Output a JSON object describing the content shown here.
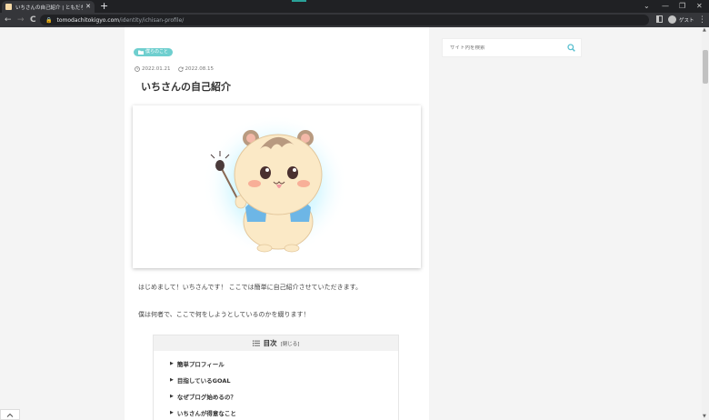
{
  "browser": {
    "tab_title": "いちさんの自己紹介 | ともだちと起業",
    "tab_close": "✕",
    "new_tab": "+",
    "url_host": "tomodachitokigyo.com",
    "url_path": "/identity/ichisan-profile/",
    "profile_label": "ゲスト",
    "back": "←",
    "forward": "→",
    "reload": "C",
    "minimize": "—",
    "restore": "❐",
    "close": "✕",
    "dropdown": "⌄",
    "menu": "⋮"
  },
  "article": {
    "category": "僕らのこと",
    "published": "2022.01.21",
    "updated": "2022.08.15",
    "title": "いちさんの自己紹介",
    "intro1": "はじめまして！いちさんです！ ここでは簡単に自己紹介させていただきます。",
    "intro2": "僕は何者で、ここで何をしようとしているのかを綴ります！"
  },
  "toc": {
    "title": "目次",
    "toggle": "[閉じる]",
    "items": [
      "簡単プロフィール",
      "目指しているGOAL",
      "なぜブログ始めるの？",
      "いちさんが得意なこと"
    ]
  },
  "sidebar": {
    "search_placeholder": "サイト内を検索"
  },
  "colors": {
    "accent": "#6fcfcf",
    "search_icon": "#5bc0d0"
  },
  "icons": [
    "folder-icon",
    "clock-icon",
    "refresh-icon",
    "list-icon",
    "search-icon",
    "chevron-up-icon"
  ]
}
